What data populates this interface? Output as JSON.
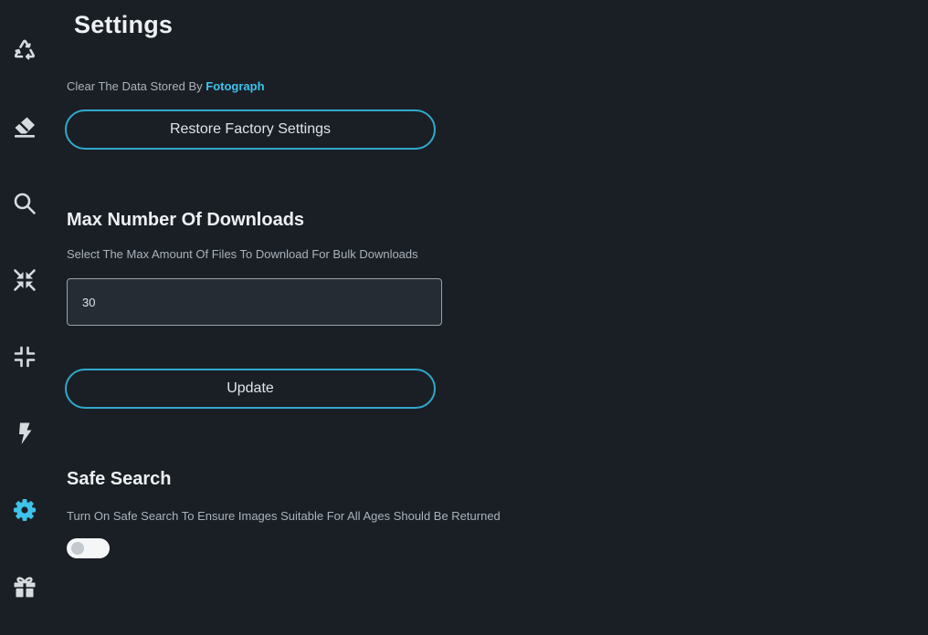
{
  "colors": {
    "background": "#1a1f25",
    "accent": "#3ec3ea",
    "icon": "#d6dbe0"
  },
  "sidebar": {
    "items": [
      {
        "icon": "recycle-icon",
        "active": false
      },
      {
        "icon": "eraser-icon",
        "active": false
      },
      {
        "icon": "search-icon",
        "active": false
      },
      {
        "icon": "compress-arrows-icon",
        "active": false
      },
      {
        "icon": "compress-icon",
        "active": false
      },
      {
        "icon": "bolt-icon",
        "active": false
      },
      {
        "icon": "gear-icon",
        "active": true
      },
      {
        "icon": "gift-icon",
        "active": false
      }
    ]
  },
  "page": {
    "title": "Settings"
  },
  "clear_data": {
    "description": "Clear The Data Stored By",
    "brand": "Fotograph",
    "button_label": "Restore Factory Settings"
  },
  "max_downloads": {
    "heading": "Max Number Of Downloads",
    "description": "Select The Max Amount Of Files To Download For Bulk Downloads",
    "value": "30",
    "button_label": "Update"
  },
  "safe_search": {
    "heading": "Safe Search",
    "description": "Turn On Safe Search To Ensure Images Suitable For All Ages Should Be Returned",
    "enabled": false
  }
}
